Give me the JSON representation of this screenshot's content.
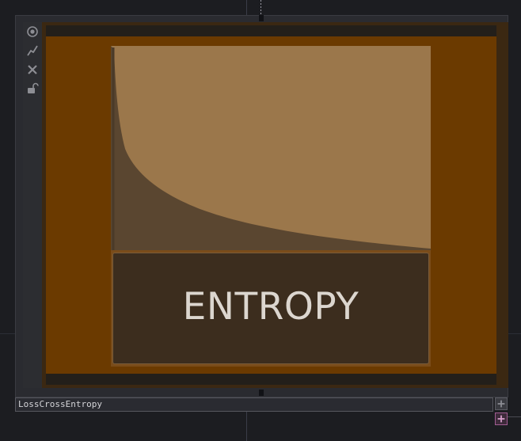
{
  "node": {
    "name": "LossCrossEntropy",
    "icon_label": "ENTROPY"
  },
  "toolbar": {
    "icons": [
      "viewer-toggle-icon",
      "bypass-icon",
      "close-icon",
      "lock-icon"
    ]
  },
  "colors": {
    "canvas": "#1c1d21",
    "viewer_background": "#6b3a00",
    "plot_fill": "#9b774b",
    "curve_fill": "#5a4630",
    "label_box": "#3c2d1e",
    "label_text": "#dcd6cf"
  }
}
